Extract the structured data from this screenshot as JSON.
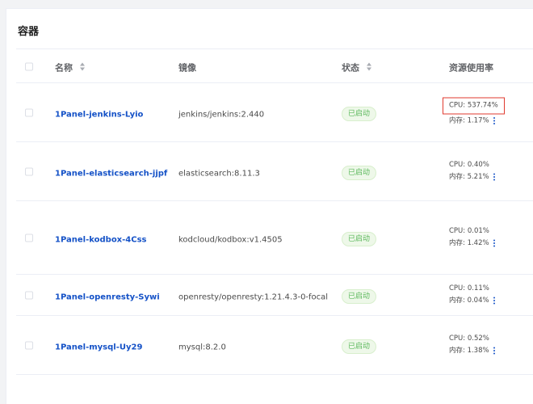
{
  "card": {
    "title": "容器"
  },
  "table": {
    "headers": {
      "name": "名称",
      "image": "镜像",
      "status": "状态",
      "resource": "资源使用率"
    },
    "rows": [
      {
        "name": "1Panel-jenkins-Lyio",
        "image": "jenkins/jenkins:2.440",
        "status": "已启动",
        "cpu": "CPU: 537.74%",
        "mem": "内存: 1.17%"
      },
      {
        "name": "1Panel-elasticsearch-jjpf",
        "image": "elasticsearch:8.11.3",
        "status": "已启动",
        "cpu": "CPU: 0.40%",
        "mem": "内存: 5.21%"
      },
      {
        "name": "1Panel-kodbox-4Css",
        "image": "kodcloud/kodbox:v1.4505",
        "status": "已启动",
        "cpu": "CPU: 0.01%",
        "mem": "内存: 1.42%"
      },
      {
        "name": "1Panel-openresty-Sywi",
        "image": "openresty/openresty:1.21.4.3-0-focal",
        "status": "已启动",
        "cpu": "CPU: 0.11%",
        "mem": "内存: 0.04%"
      },
      {
        "name": "1Panel-mysql-Uy29",
        "image": "mysql:8.2.0",
        "status": "已启动",
        "cpu": "CPU: 0.52%",
        "mem": "内存: 1.38%"
      }
    ]
  },
  "icons": {
    "sort": "sort-icon",
    "more": "more-vertical-icon"
  },
  "colors": {
    "link": "#1552c7",
    "status_text": "#5cb85c",
    "status_bg": "#eef8e9",
    "highlight_box": "#e03a2f"
  }
}
